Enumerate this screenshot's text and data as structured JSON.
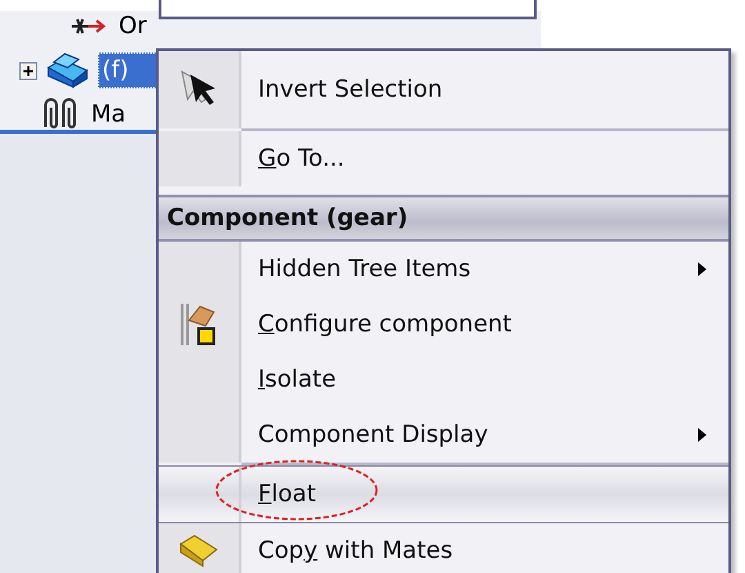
{
  "tree": {
    "items": [
      {
        "kind": "origin",
        "label": "Or",
        "selected": false
      },
      {
        "kind": "part",
        "label": "(f)",
        "selected": true
      },
      {
        "kind": "mates",
        "label": "Ma",
        "selected": false
      }
    ]
  },
  "context_menu": {
    "items": [
      {
        "kind": "item",
        "label": "Invert Selection",
        "submenu": false,
        "selected": false,
        "circled": false
      },
      {
        "kind": "separator"
      },
      {
        "kind": "item",
        "label": "Go To...",
        "submenu": false,
        "selected": false,
        "circled": false
      },
      {
        "kind": "header",
        "label": "Component (gear)"
      },
      {
        "kind": "item",
        "label": "Hidden Tree Items",
        "submenu": true,
        "selected": false,
        "circled": false
      },
      {
        "kind": "item",
        "label": "Configure component",
        "submenu": false,
        "selected": false,
        "circled": false
      },
      {
        "kind": "item",
        "label": "Isolate",
        "submenu": false,
        "selected": false,
        "circled": false
      },
      {
        "kind": "item",
        "label": "Component Display",
        "submenu": true,
        "selected": false,
        "circled": false
      },
      {
        "kind": "separator"
      },
      {
        "kind": "item",
        "label": "Float",
        "submenu": false,
        "selected": true,
        "circled": true
      },
      {
        "kind": "item",
        "label": "Copy with Mates",
        "submenu": false,
        "selected": false,
        "circled": false
      }
    ]
  }
}
